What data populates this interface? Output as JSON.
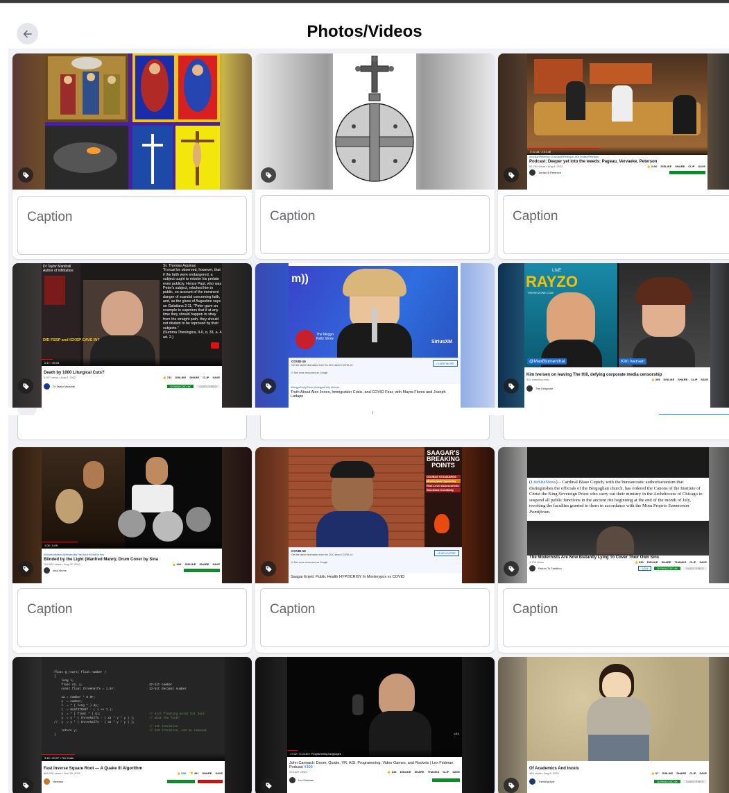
{
  "header": {
    "title": "Photos/Videos"
  },
  "caption_placeholder": "Caption",
  "colors": {
    "accent": "#1877f2",
    "panel_bg": "#f0f2f5",
    "caption_border": "#ccd0d5"
  },
  "cards": [
    {
      "id": "1",
      "alt": "collage"
    },
    {
      "id": "2",
      "alt": "orb-cross"
    },
    {
      "id": "3",
      "tags": "#JordanPeterson #JordanBPeterson #DrJordanPeterson",
      "title": "Podcast: Deeper yet into the weeds: Pageau, Vervaeke, Peterson",
      "meta": "52,284 views • Aug 8, 2022",
      "likes": "2.6K",
      "actions": [
        "DISLIKE",
        "SHARE",
        "CLIP",
        "SAVE"
      ],
      "channel": "Jordan B Peterson",
      "time": "2:10:38 / 2:31:48"
    },
    {
      "id": "4",
      "overlay_left": "Dr Taylor Marshall\nAuthor of Infiltration:",
      "overlay_quote": "St. Thomas Aquinas\n\"It must be observed, however, that\nif the faith were endangered, a\nsubject ought to rebuke his prelate\neven publicly. Hence Paul, who was\nPeter's subject, rebuked him in\npublic, on account of the imminent\ndanger of scandal concerning faith,\nand, as the gloss of Augustine says\non Galatians 2:11, \"Peter gave an\nexample to superiors that if at any\ntime they should happen to stray\nfrom the straight path, they should\nnot disdain to be reproved by their\nsubjects.\"\n(Summa Theologica, II-II, q. 33, a. 4,\nad. 2.)",
      "overlay_bottom": "DID FSSP and ICKSP CAVE IN?",
      "time": "0:17 / 35:03",
      "title": "Death by 1000 Liturgical Cuts?",
      "meta": "5,057 views • Aug 8, 2022",
      "likes": "732",
      "actions": [
        "DISLIKE",
        "SHARE",
        "CLIP",
        "SAVE"
      ],
      "channel": "Dr Taylor Marshall",
      "download": "DOWNLOAD 4K",
      "subscribed": "SUBSCRIBED"
    },
    {
      "id": "5",
      "brand": "SiriusXM",
      "show": "The Megyn Kelly Show",
      "covid_title": "COVID-19",
      "covid_sub": "Get the latest information from the CDC about COVID-19.",
      "covid_more": "See more resources on Google",
      "learn_more": "LEARN MORE",
      "tags": "#MegynKellyShow #MegynKelly #News",
      "title": "Truth About Alex Jones, Immigration Crisis, and COVID Fear, with Mayra Flores and Joseph Ladapo"
    },
    {
      "id": "6",
      "live": "LIVE",
      "show": "RAYZO",
      "site": "THERAYZONE.COM",
      "left_name": "@MaxBlumenthal",
      "right_name": "Kim Iversen",
      "title": "Kim Iversen on leaving The Hill, defying corporate media censorship",
      "meta": "910 watching now...",
      "likes": "355",
      "actions": [
        "DISLIKE",
        "SHARE",
        "CLIP",
        "SAVE"
      ],
      "channel": "The Grayzone"
    },
    {
      "id": "7",
      "tags": "#ManfredMann #BlindedByTheLight #SinaDrums",
      "title": "Blinded by the Light (Manfred Mann); Drum Cover by Sina",
      "meta": "784,522 views • Aug 26, 2020",
      "likes": "18K",
      "actions": [
        "DISLIKE",
        "SHARE",
        "SAVE"
      ],
      "channel": "sina-drums",
      "time": "1:00 / 5:09"
    },
    {
      "id": "8",
      "brand_lines": [
        "SAAGAR'S",
        "BREAKING",
        "POINTS"
      ],
      "topics": [
        "DOUBLE STANDARDS",
        "Monkeypox Hypocrisy",
        "Risk Level Assessments",
        "Shredded Credibility"
      ],
      "covid_title": "COVID-19",
      "covid_sub": "Get the latest information from the CDC about COVID-19.",
      "covid_more": "See more resources on Google",
      "learn_more": "LEARN MORE",
      "title": "Saagar Enjeti: Public Health HYPOCRISY In Monkeypox vs COVID"
    },
    {
      "id": "9",
      "link_text": "LifeSiteNews",
      "body": " – Cardinal Blase Cupich, with the bureaucratic authoritarianism that distinguishes the officials of the Bergoglian church, has ordered the Canons of the Institute of Christ the King Sovereign Priest who carry out their ministry in the Archdiocese of Chicago to suspend all public functions in the ancient rite beginning at the end of the month of July, revoking the faculties granted to them in accordance with the Motu Proprio ",
      "italic": "Summorum Pontificum.",
      "title": "The Modernists Are Now Blatantly Lying To Cover Their Own Sins",
      "meta": "3,709 views",
      "likes": "830",
      "actions": [
        "DISLIKE",
        "SHARE",
        "THANKS",
        "CLIP",
        "SAVE"
      ],
      "channel": "Return To Tradition",
      "join": "JOIN",
      "download": "DOWNLOAD 4K",
      "subscribed": "SUBSCRIBED"
    },
    {
      "id": "10",
      "code_lines": [
        "float Q_rsqrt( float number )",
        "{",
        "    long i;",
        "    float x2, y;",
        "    const float threehalfs = 1.5F;",
        "",
        "    x2 = number * 0.5F;",
        "    y  = number;",
        "    i  = * ( long * ) &y;",
        "    i  = 0x5f3759df - ( i >> 1 );",
        "    y  = * ( float * ) &i;",
        "    y  = y * ( threehalfs - ( x2 * y * y ) );",
        "//  y  = y * ( threehalfs - ( x2 * y * y ) );",
        "",
        "    return y;",
        "}"
      ],
      "code_right": [
        "32-bit number",
        "32-bit decimal number"
      ],
      "code_comments": [
        "// evil floating point bit hack",
        "// what the fuck?",
        "",
        "// 1st iteration",
        "// 2nd iteration, can be removed"
      ],
      "time": "3:42 / 20:07 • The Code",
      "title": "Fast Inverse Square Root — A Quake III Algorithm",
      "meta": "866,206 views • Nov 28, 2020",
      "likes": "54K",
      "dislikes": "491",
      "actions": [
        "SHARE",
        "SAVE"
      ],
      "channel": "Nemean"
    },
    {
      "id": "11",
      "lex": "LEX",
      "time": "17:02 / 5:14:30 • Programming languages",
      "title": "John Carmack: Doom, Quake, VR, AGI, Programming, Video Games, and Rockets | Lex Fridman Podcast ",
      "podcast_no": "#309",
      "meta": "375,627 views",
      "likes": "14K",
      "actions": [
        "DISLIKE",
        "SHARE",
        "THANKS",
        "CLIP",
        "SAVE"
      ],
      "channel": "Lex Fridman"
    },
    {
      "id": "12",
      "title": "Of Academics And Incels",
      "meta": "483 views • Aug 8, 2022",
      "likes": "67",
      "actions": [
        "DISLIKE",
        "SHARE",
        "CLIP",
        "SAVE"
      ],
      "channel": "Thinking Ape",
      "download": "DOWNLOAD 4K",
      "subscribed": "SUBSCRIBED"
    }
  ]
}
